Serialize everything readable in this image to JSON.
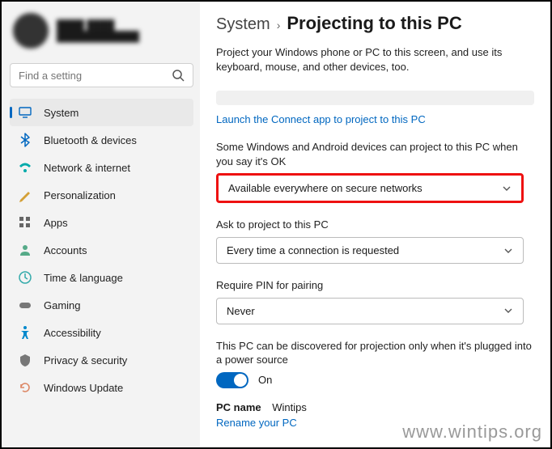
{
  "user": {
    "name": "████ ████",
    "email": "████████████"
  },
  "search": {
    "placeholder": "Find a setting"
  },
  "sidebar": {
    "items": [
      {
        "label": "System"
      },
      {
        "label": "Bluetooth & devices"
      },
      {
        "label": "Network & internet"
      },
      {
        "label": "Personalization"
      },
      {
        "label": "Apps"
      },
      {
        "label": "Accounts"
      },
      {
        "label": "Time & language"
      },
      {
        "label": "Gaming"
      },
      {
        "label": "Accessibility"
      },
      {
        "label": "Privacy & security"
      },
      {
        "label": "Windows Update"
      }
    ]
  },
  "breadcrumb": {
    "parent": "System",
    "current": "Projecting to this PC"
  },
  "main": {
    "description": "Project your Windows phone or PC to this screen, and use its keyboard, mouse, and other devices, too.",
    "launch_link": "Launch the Connect app to project to this PC",
    "availability": {
      "label": "Some Windows and Android devices can project to this PC when you say it's OK",
      "value": "Available everywhere on secure networks"
    },
    "ask": {
      "label": "Ask to project to this PC",
      "value": "Every time a connection is requested"
    },
    "pin": {
      "label": "Require PIN for pairing",
      "value": "Never"
    },
    "discoverable": {
      "label": "This PC can be discovered for projection only when it's plugged into a power source",
      "state": "On"
    },
    "pc": {
      "label": "PC name",
      "value": "Wintips",
      "rename": "Rename your PC"
    }
  },
  "watermark": "www.wintips.org"
}
